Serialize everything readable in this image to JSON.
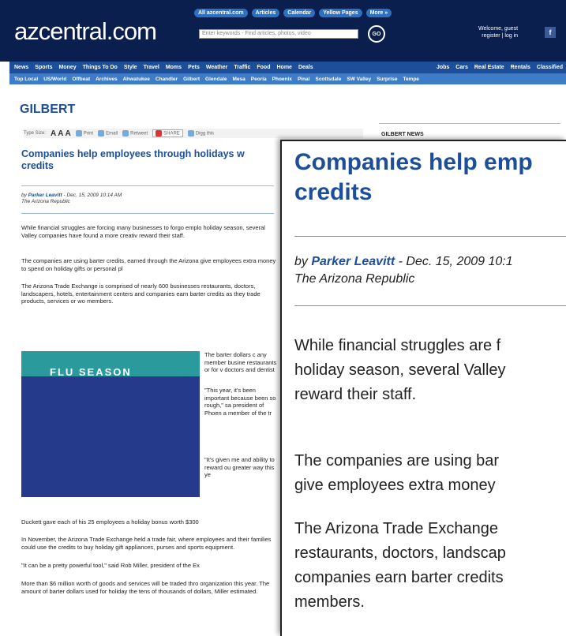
{
  "header": {
    "logo": "azcentral.com",
    "pills": [
      "All azcentral.com",
      "Articles",
      "Calendar",
      "Yellow Pages",
      "More »"
    ],
    "search_placeholder": "Enter keywords - Find articles, photos, video",
    "go_label": "GO",
    "welcome_line1": "Welcome, guest",
    "welcome_line2": "register | log in",
    "facebook_label": "f"
  },
  "nav_primary": [
    "News",
    "Sports",
    "Money",
    "Things To Do",
    "Style",
    "Travel",
    "Moms",
    "Pets",
    "Weather",
    "Traffic",
    "Food",
    "Home",
    "Deals"
  ],
  "nav_primary_right": [
    "Jobs",
    "Cars",
    "Real Estate",
    "Rentals",
    "Classified"
  ],
  "nav_secondary": [
    "Top Local",
    "US/World",
    "Offbeat",
    "Archives",
    "Ahwatukee",
    "Chandler",
    "Gilbert",
    "Glendale",
    "Mesa",
    "Peoria",
    "Phoenix",
    "Pinal",
    "Scottsdale",
    "SW Valley",
    "Surprise",
    "Tempe"
  ],
  "article": {
    "section": "GILBERT",
    "toolbar": {
      "type_size_label": "Type Size:",
      "type_size_glyphs": "A A A",
      "print": "Print",
      "email": "Email",
      "retweet": "Retweet",
      "share": "SHARE",
      "digg": "Digg this"
    },
    "headline": "Companies help employees through holidays w",
    "headline_line2": "credits",
    "byline_prefix": "by ",
    "author": "Parker Leavitt",
    "dateline": " - Dec. 15, 2009 10:14 AM",
    "publication": "The Arizona Republic",
    "p1": "While financial struggles are forcing many businesses to forgo emplo holiday season, several Valley companies have found a more creativ reward their staff.",
    "p2": "The companies are using barter credits, earned through the Arizona give employees extra money to spend on holiday gifts or personal pl",
    "p3": "The Arizona Trade Exchange is comprised of nearly 600 businesses restaurants, doctors, landscapers, hotels, entertainment centers and companies earn barter credits as they trade products, services or wo members.",
    "p4": "The barter dollars c any member busine restaurants or for v doctors and dentist",
    "p5": "\"This year, it's been important because been so rough,\" sa president of Phoen a member of the tr",
    "p6": "\"It's given me and ability to reward ou greater way this ye",
    "p7": "Duckett gave each of his 25 employees a holiday bonus worth $300",
    "p8": "In November, the Arizona Trade Exchange held a trade fair, where employees and their families could use the credits to buy holiday gift appliances, purses and sports equipment.",
    "p9": "\"It can be a pretty powerful tool,\" said Rob Miller, president of the Ex",
    "p10": "More than $6 million worth of goods and services will be traded thro organization this year. The amount of barter dollars used for holiday the tens of thousands of dollars, Miller estimated.",
    "image_text": "FLU SEASON"
  },
  "sidebar": {
    "heading": "GILBERT NEWS"
  },
  "zoom": {
    "headline": "Companies help emp\ncredits",
    "byline_prefix": "by ",
    "author": "Parker Leavitt",
    "dateline": " - Dec. 15, 2009 10:1",
    "publication": "The Arizona Republic",
    "p1": "While financial struggles are f\nholiday season, several Valley\nreward their staff.",
    "p2": "The companies are using bar\ngive employees extra money",
    "p3": "The Arizona Trade Exchange\nrestaurants, doctors, landscap\ncompanies earn barter credits\nmembers."
  },
  "colors": {
    "header_bg": "#0a1f4d",
    "nav_primary_bg": "#1d4e9a",
    "nav_secondary_bg": "#3f7cc8",
    "link_blue": "#1d4e9a"
  }
}
